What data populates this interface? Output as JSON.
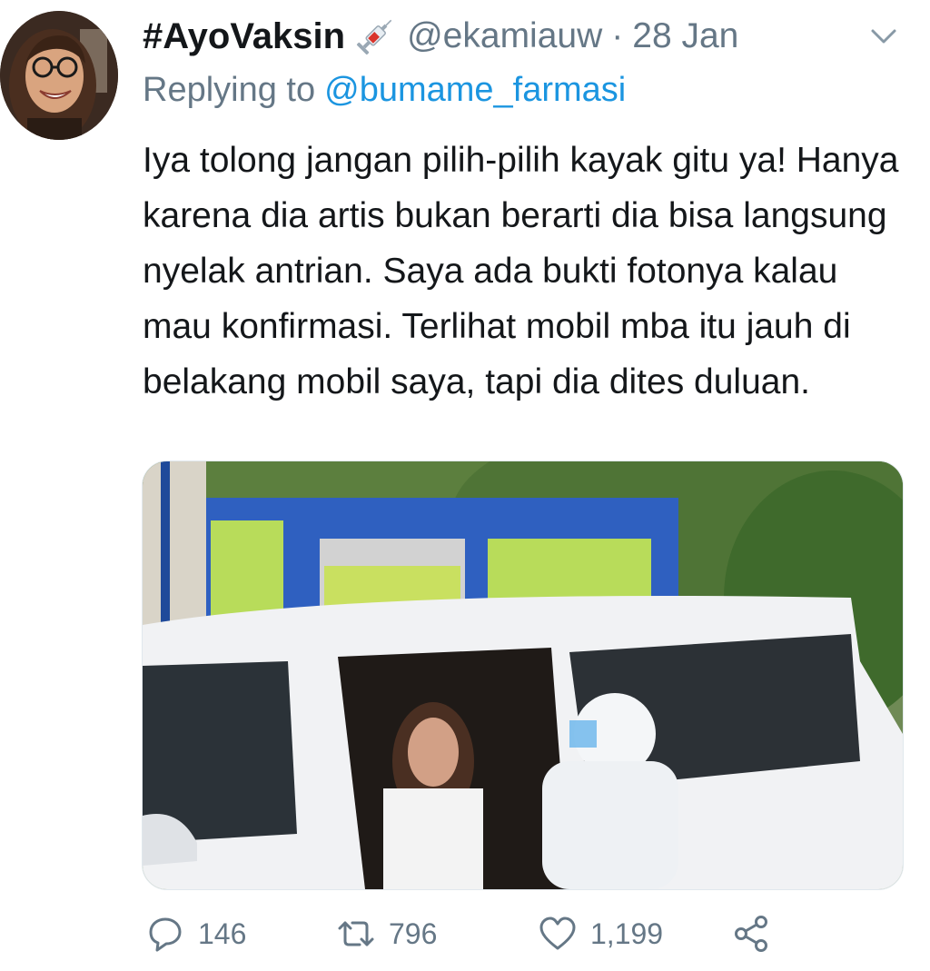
{
  "tweet": {
    "display_name": "#AyoVaksin",
    "name_emoji": "syringe-icon",
    "handle": "@ekamiauw",
    "separator": "·",
    "date": "28 Jan",
    "replying_prefix": "Replying to",
    "replying_to": "@bumame_farmasi",
    "text": "Iya tolong jangan pilih-pilih kayak gitu ya! Hanya karena dia artis bukan berarti dia bisa langsung nyelak antrian. Saya ada bukti fotonya kalau mau konfirmasi. Terlihat mobil mba itu jauh di belakang mobil saya, tapi dia dites duluan."
  },
  "actions": {
    "replies": "146",
    "retweets": "796",
    "likes": "1,199"
  },
  "colors": {
    "text": "#14171a",
    "secondary": "#657786",
    "link": "#1b95e0"
  }
}
